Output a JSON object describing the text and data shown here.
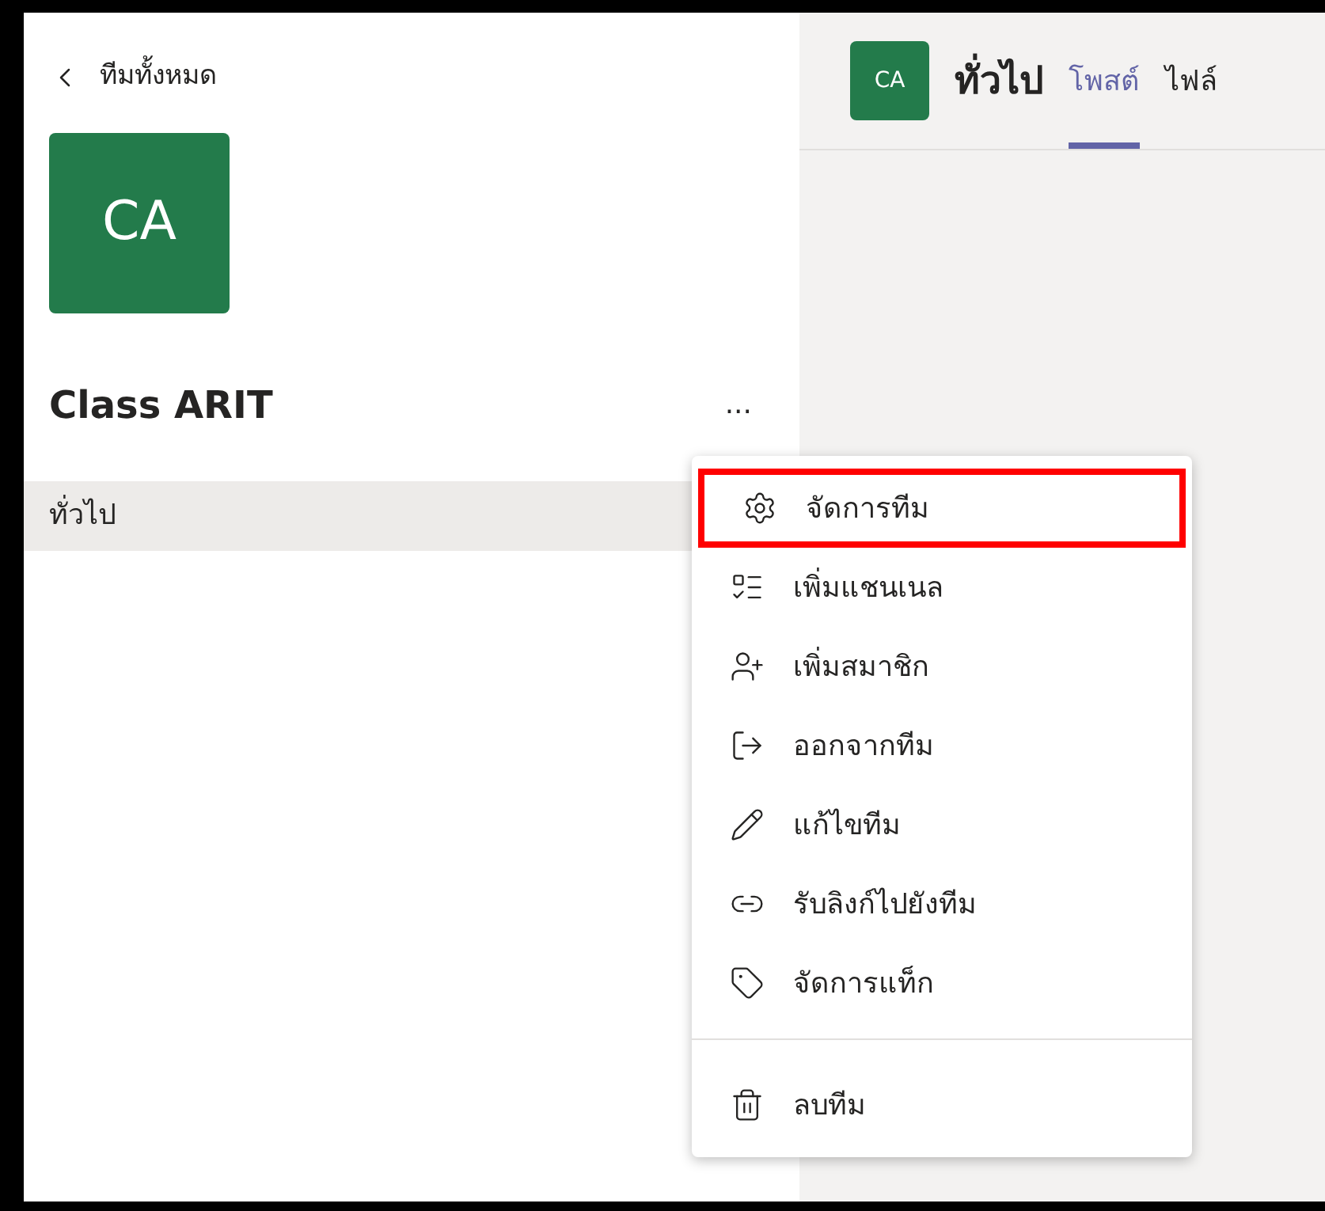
{
  "sidebar": {
    "back_link": "ทีมทั้งหมด",
    "team_avatar": "CA",
    "team_name": "Class ARIT",
    "more_button": "...",
    "channels": [
      {
        "label": "ทั่วไป",
        "selected": true
      }
    ]
  },
  "channel_header": {
    "avatar": "CA",
    "title": "ทั่วไป",
    "tabs": [
      {
        "label": "โพสต์",
        "selected": true
      },
      {
        "label": "ไฟล์",
        "selected": false
      }
    ]
  },
  "team_menu": {
    "groups": [
      [
        {
          "label": "จัดการทีม",
          "highlighted": true
        },
        {
          "label": "เพิ่มแชนเนล",
          "highlighted": false
        },
        {
          "label": "เพิ่มสมาชิก",
          "highlighted": false
        },
        {
          "label": "ออกจากทีม",
          "highlighted": false
        },
        {
          "label": "แก้ไขทีม",
          "highlighted": false
        },
        {
          "label": "รับลิงก์ไปยังทีม",
          "highlighted": false
        },
        {
          "label": "จัดการแท็ก",
          "highlighted": false
        }
      ],
      [
        {
          "label": "ลบทีม",
          "highlighted": false
        }
      ]
    ]
  }
}
